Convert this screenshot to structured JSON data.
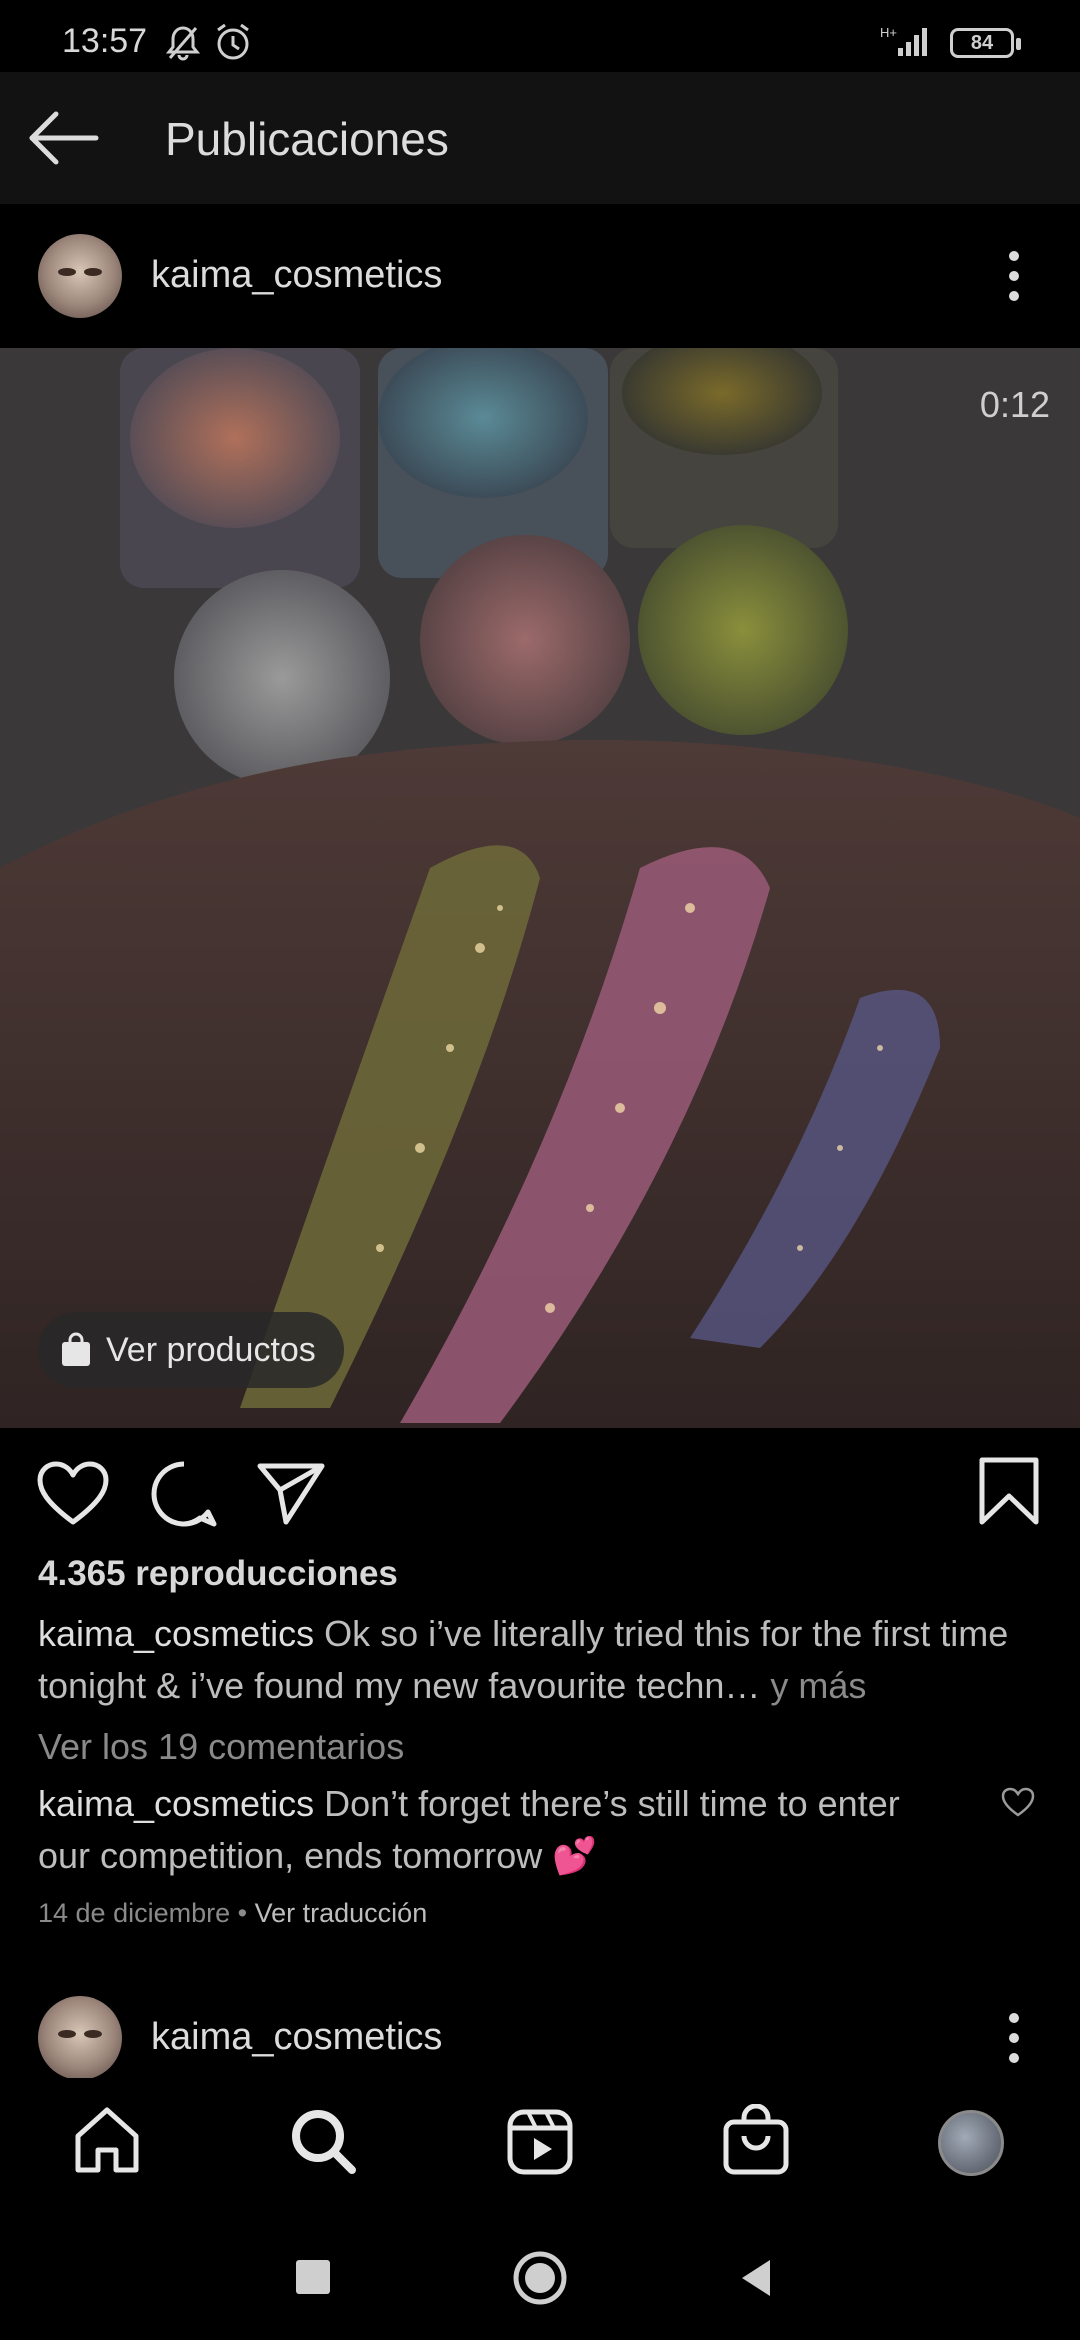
{
  "status": {
    "time": "13:57",
    "network": "H+",
    "battery": "84"
  },
  "top_bar": {
    "title": "Publicaciones"
  },
  "post": {
    "username": "kaima_cosmetics",
    "video_time": "0:12",
    "products_label": "Ver productos",
    "views": "4.365 reproducciones",
    "caption_user": "kaima_cosmetics",
    "caption_text": "Ok so i’ve literally tried this for the first time tonight & i’ve found my new favourite techn…",
    "caption_more": "y más",
    "comments_link": "Ver los 19 comentarios",
    "comment_user": "kaima_cosmetics",
    "comment_text": "Don’t forget there’s still time to enter our competition, ends tomorrow 💕",
    "date": "14 de diciembre",
    "separator": "•",
    "translate": "Ver traducción"
  },
  "next_post": {
    "username": "kaima_cosmetics"
  },
  "icons": {
    "back": "arrow-left-icon",
    "like": "heart-icon",
    "comment": "comment-icon",
    "share": "send-icon",
    "save": "bookmark-icon",
    "home": "home-icon",
    "search": "search-icon",
    "reels": "reels-icon",
    "shop": "shop-icon",
    "profile": "profile-avatar"
  },
  "colors": {
    "background": "#000000",
    "top_bar": "#121212",
    "comment_heart": "#e0245e"
  }
}
